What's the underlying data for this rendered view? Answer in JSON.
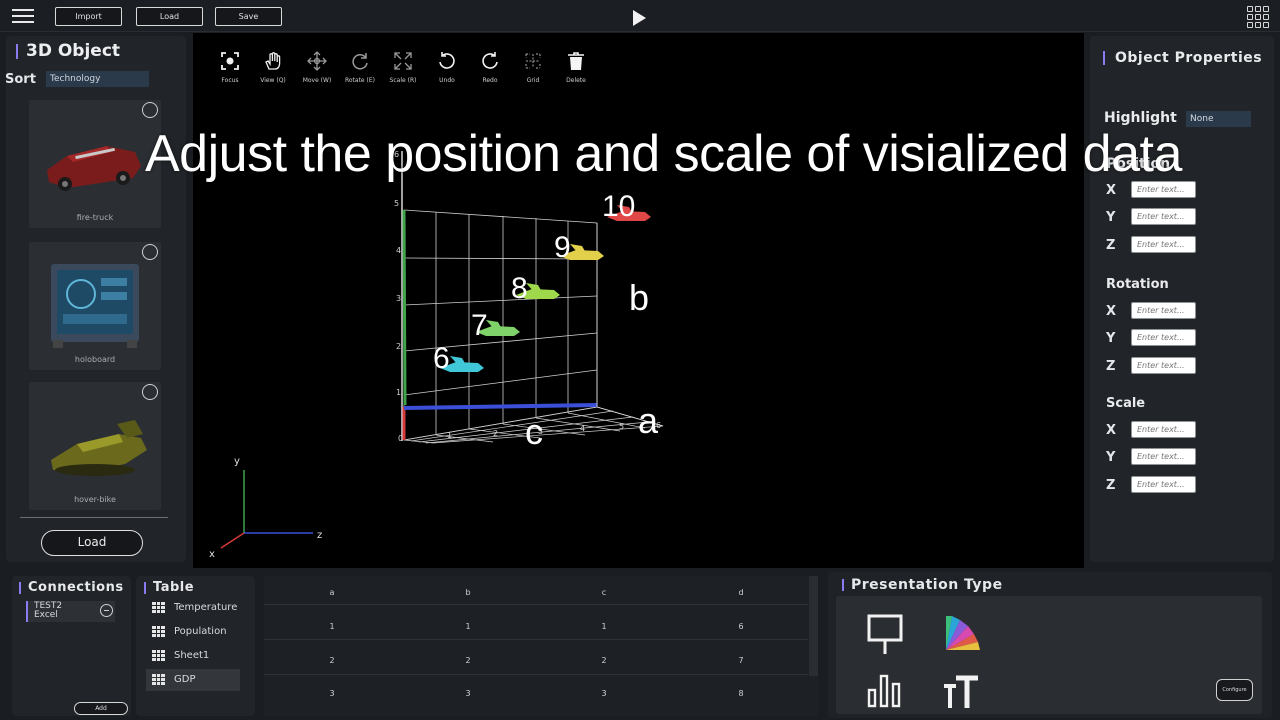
{
  "topbar": {
    "import_label": "Import",
    "load_label": "Load",
    "save_label": "Save"
  },
  "left_panel": {
    "title": "3D Object",
    "sort_label": "Sort",
    "sort_value": "Technology",
    "items": [
      {
        "label": "fire-truck"
      },
      {
        "label": "holoboard"
      },
      {
        "label": "hover-bike"
      }
    ],
    "load_button": "Load"
  },
  "toolbar": {
    "tools": [
      {
        "label": "Focus",
        "icon": "focus-icon"
      },
      {
        "label": "View (Q)",
        "icon": "hand-icon"
      },
      {
        "label": "Move (W)",
        "icon": "move-icon"
      },
      {
        "label": "Rotate (E)",
        "icon": "rotate-icon"
      },
      {
        "label": "Scale (R)",
        "icon": "scale-icon"
      },
      {
        "label": "Undo",
        "icon": "undo-icon"
      },
      {
        "label": "Redo",
        "icon": "redo-icon"
      },
      {
        "label": "Grid",
        "icon": "grid-icon"
      },
      {
        "label": "Delete",
        "icon": "trash-icon"
      }
    ]
  },
  "viewport": {
    "caption": "Adjust the position and scale of visialized data",
    "axis_labels": {
      "a": "a",
      "b": "b",
      "c": "c"
    },
    "gizmo": {
      "x": "x",
      "y": "y",
      "z": "z"
    },
    "ticks_a": [
      "0",
      "1",
      "2",
      "3",
      "4",
      "5",
      "6"
    ],
    "ticks_b": [
      "1",
      "2",
      "3",
      "4",
      "5",
      "6"
    ],
    "data_labels": [
      "6",
      "7",
      "8",
      "9",
      "10"
    ],
    "plane_colors": [
      "#41c8d8",
      "#7fd16a",
      "#9fd84a",
      "#e3d04a",
      "#e04848"
    ]
  },
  "right_panel": {
    "title": "Object Properties",
    "highlight_label": "Highlight",
    "highlight_value": "None",
    "position_label": "Position",
    "rotation_label": "Rotation",
    "scale_label": "Scale",
    "x": "X",
    "y": "Y",
    "z": "Z",
    "placeholder": "Enter text..."
  },
  "connections": {
    "title": "Connections",
    "item_line1": "TEST2",
    "item_line2": "Excel",
    "add_label": "Add"
  },
  "table_panel": {
    "title": "Table",
    "items": [
      "Temperature",
      "Population",
      "Sheet1",
      "GDP"
    ]
  },
  "data_table": {
    "headers": [
      "a",
      "b",
      "c",
      "d"
    ],
    "rows": [
      [
        "1",
        "1",
        "1",
        "6"
      ],
      [
        "2",
        "2",
        "2",
        "7"
      ],
      [
        "3",
        "3",
        "3",
        "8"
      ]
    ]
  },
  "presentation": {
    "title": "Presentation Type",
    "configure_label": "Configure"
  },
  "colors": {
    "accent": "#8a7cf0",
    "panel": "#212428"
  }
}
